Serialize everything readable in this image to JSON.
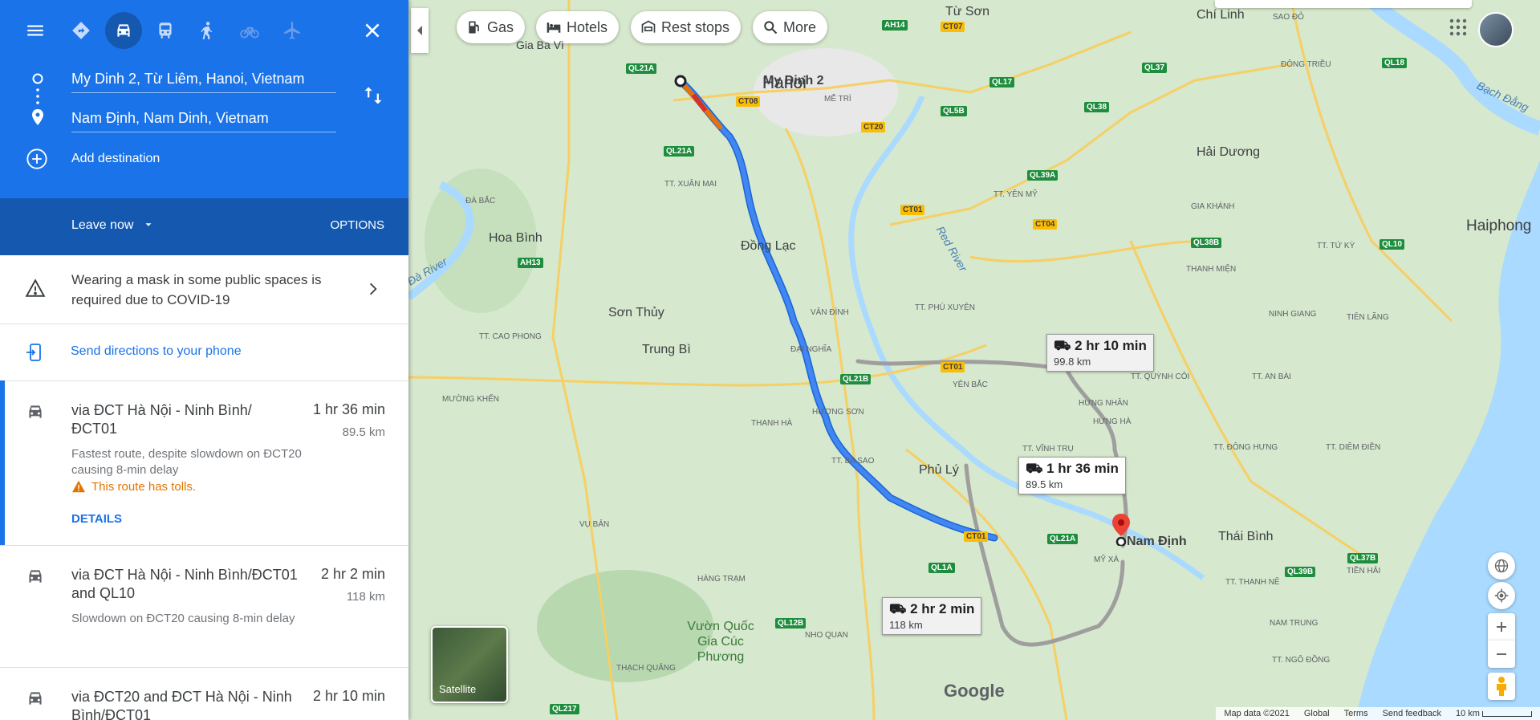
{
  "colors": {
    "header_blue": "#1a73e8",
    "header_dark": "#1558b0",
    "route_blue": "#4285f4",
    "alt_route": "#9e9e9e",
    "warning": "#e37400"
  },
  "modes": [
    {
      "name": "directions-icon"
    },
    {
      "name": "car-icon",
      "active": true
    },
    {
      "name": "transit-icon"
    },
    {
      "name": "walking-icon"
    },
    {
      "name": "cycling-icon"
    },
    {
      "name": "flight-icon"
    }
  ],
  "origin": "My Dinh 2, Từ Liêm, Hanoi, Vietnam",
  "destination": "Nam Định, Nam Dinh, Vietnam",
  "add_destination": "Add destination",
  "leave_now": "Leave now",
  "options": "OPTIONS",
  "notice": "Wearing a mask in some public spaces is required due to COVID-19",
  "send_directions": "Send directions to your phone",
  "routes": [
    {
      "title": "via ĐCT Hà Nội - Ninh Bình/ ĐCT01",
      "time": "1 hr 36 min",
      "distance": "89.5 km",
      "desc": "Fastest route, despite slowdown on ĐCT20 causing 8-min delay",
      "toll": "This route has tolls.",
      "details": "DETAILS"
    },
    {
      "title": "via ĐCT Hà Nội - Ninh Bình/ĐCT01 and QL10",
      "time": "2 hr 2 min",
      "distance": "118 km",
      "desc": "Slowdown on ĐCT20 causing 8-min delay"
    },
    {
      "title": "via ĐCT20 and ĐCT Hà Nội - Ninh Bình/ĐCT01",
      "time": "2 hr 10 min",
      "distance": "99.8 km"
    }
  ],
  "chips": [
    "Gas",
    "Hotels",
    "Rest stops",
    "More"
  ],
  "callouts": {
    "main": {
      "time": "1 hr 36 min",
      "dist": "89.5 km"
    },
    "alt1": {
      "time": "2 hr 10 min",
      "dist": "99.8 km"
    },
    "alt2": {
      "time": "2 hr 2 min",
      "dist": "118 km"
    }
  },
  "places": {
    "origin_label": "My Dinh 2",
    "hanoi": "Hanoi",
    "namdinh": "Nam Định",
    "haiphong": "Haiphong",
    "haiduong": "Hải Dương",
    "thaibinh": "Thái Bình",
    "hoabinh": "Hoa Bình",
    "phuly": "Phủ Lý",
    "chilinh": "Chí Linh",
    "tuson": "Từ Sơn",
    "dongLac": "Đồng Lạc",
    "sonthuy": "Sơn Thủy",
    "trungbi": "Trung Bì",
    "vuonquoc": "Vườn Quốc Gia Cúc Phương",
    "giabavi": "Gia Ba Vì",
    "redriver": "Red River",
    "dariver": "Đà River"
  },
  "small_places": [
    "MỄ TRÌ",
    "ĐÀ BẮC",
    "TT. XUÂN MAI",
    "ĐÔNG TRIỀU",
    "GIA KHÁNH",
    "THANH MIỆN",
    "TT. TỨ KỲ",
    "TT. CAO PHONG",
    "VÂN ĐÌNH",
    "TT. PHÚ XUYÊN",
    "ĐẠI NGHĨA",
    "MƯỜNG KHẾN",
    "THANH HÀ",
    "HƯƠNG SƠN",
    "YÊN BẮC",
    "TT. QUỲNH CÔI",
    "TT. AN BÀI",
    "HƯNG NHÂN",
    "HƯNG HÀ",
    "TT. VĨNH TRỤ",
    "TT. BA SAO",
    "VỤ BẢN",
    "HÀNG TRẠM",
    "NHO QUAN",
    "TT. ĐÔNG HƯNG",
    "TT. DIÊM ĐIỀN",
    "MỸ XÁ",
    "TIỀN HẢI",
    "TT. YÊN MỸ",
    "NINH GIANG",
    "TIÊN LÃNG",
    "THẠCH QUẢNG",
    "NAM TRUNG",
    "TT. NGÔ ĐỒNG",
    "TT. THANH NÊ"
  ],
  "roads_green": [
    "AH14",
    "QL21A",
    "QL17",
    "QL38",
    "QL5B",
    "QL37",
    "QL18",
    "QL39A",
    "QL38B",
    "QL10",
    "QL21B",
    "QL12B",
    "QL1A",
    "QL37B",
    "QL39B",
    "QL217",
    "AH13",
    "QL21A",
    "QL21A"
  ],
  "roads_yellow": [
    "CT07",
    "CT08",
    "CT20",
    "CT01",
    "CT04",
    "CT01",
    "CT01"
  ],
  "satellite": "Satellite",
  "map_logo": "Google",
  "footer": [
    "Map data ©2021",
    "Global",
    "Terms",
    "Send feedback",
    "10 km"
  ],
  "partial_label": "SAO ĐỎ",
  "bach_dang": "Bạch Đằng"
}
